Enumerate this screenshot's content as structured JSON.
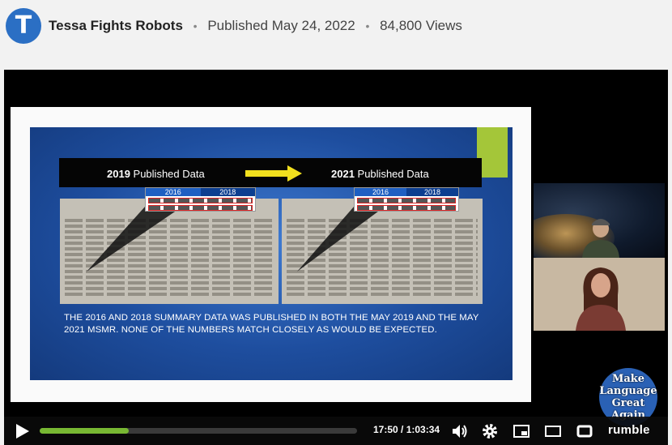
{
  "header": {
    "avatar_letter": "T",
    "channel": "Tessa Fights Robots",
    "published": "Published May 24, 2022",
    "views": "84,800 Views"
  },
  "slide": {
    "left_title_year": "2019",
    "left_title_rest": " Published Data",
    "right_title_year": "2021",
    "right_title_rest": " Published Data",
    "left_years": [
      "2016",
      "2018"
    ],
    "right_years": [
      "2016",
      "2018"
    ],
    "caption": "THE 2016 AND 2018 SUMMARY DATA WAS PUBLISHED IN BOTH THE MAY 2019 AND THE MAY 2021 MSMR. NONE OF THE NUMBERS MATCH CLOSELY AS WOULD BE EXPECTED.",
    "accent_green": "#a4c639",
    "arrow_color": "#f2e01e"
  },
  "logo": {
    "line1": "Make",
    "line2": "Language",
    "line3": "Great",
    "line4": "Again"
  },
  "controls": {
    "time": "17:50 / 1:03:34",
    "progress_fraction": 0.28,
    "brand": "rumble",
    "icons": [
      "play-icon",
      "volume-icon",
      "settings-icon",
      "pip-icon",
      "theater-icon",
      "fullscreen-icon"
    ]
  },
  "colors": {
    "avatar": "#2b6fc4",
    "progress": "#78b833",
    "slide_blue": "#1e4e9f"
  }
}
